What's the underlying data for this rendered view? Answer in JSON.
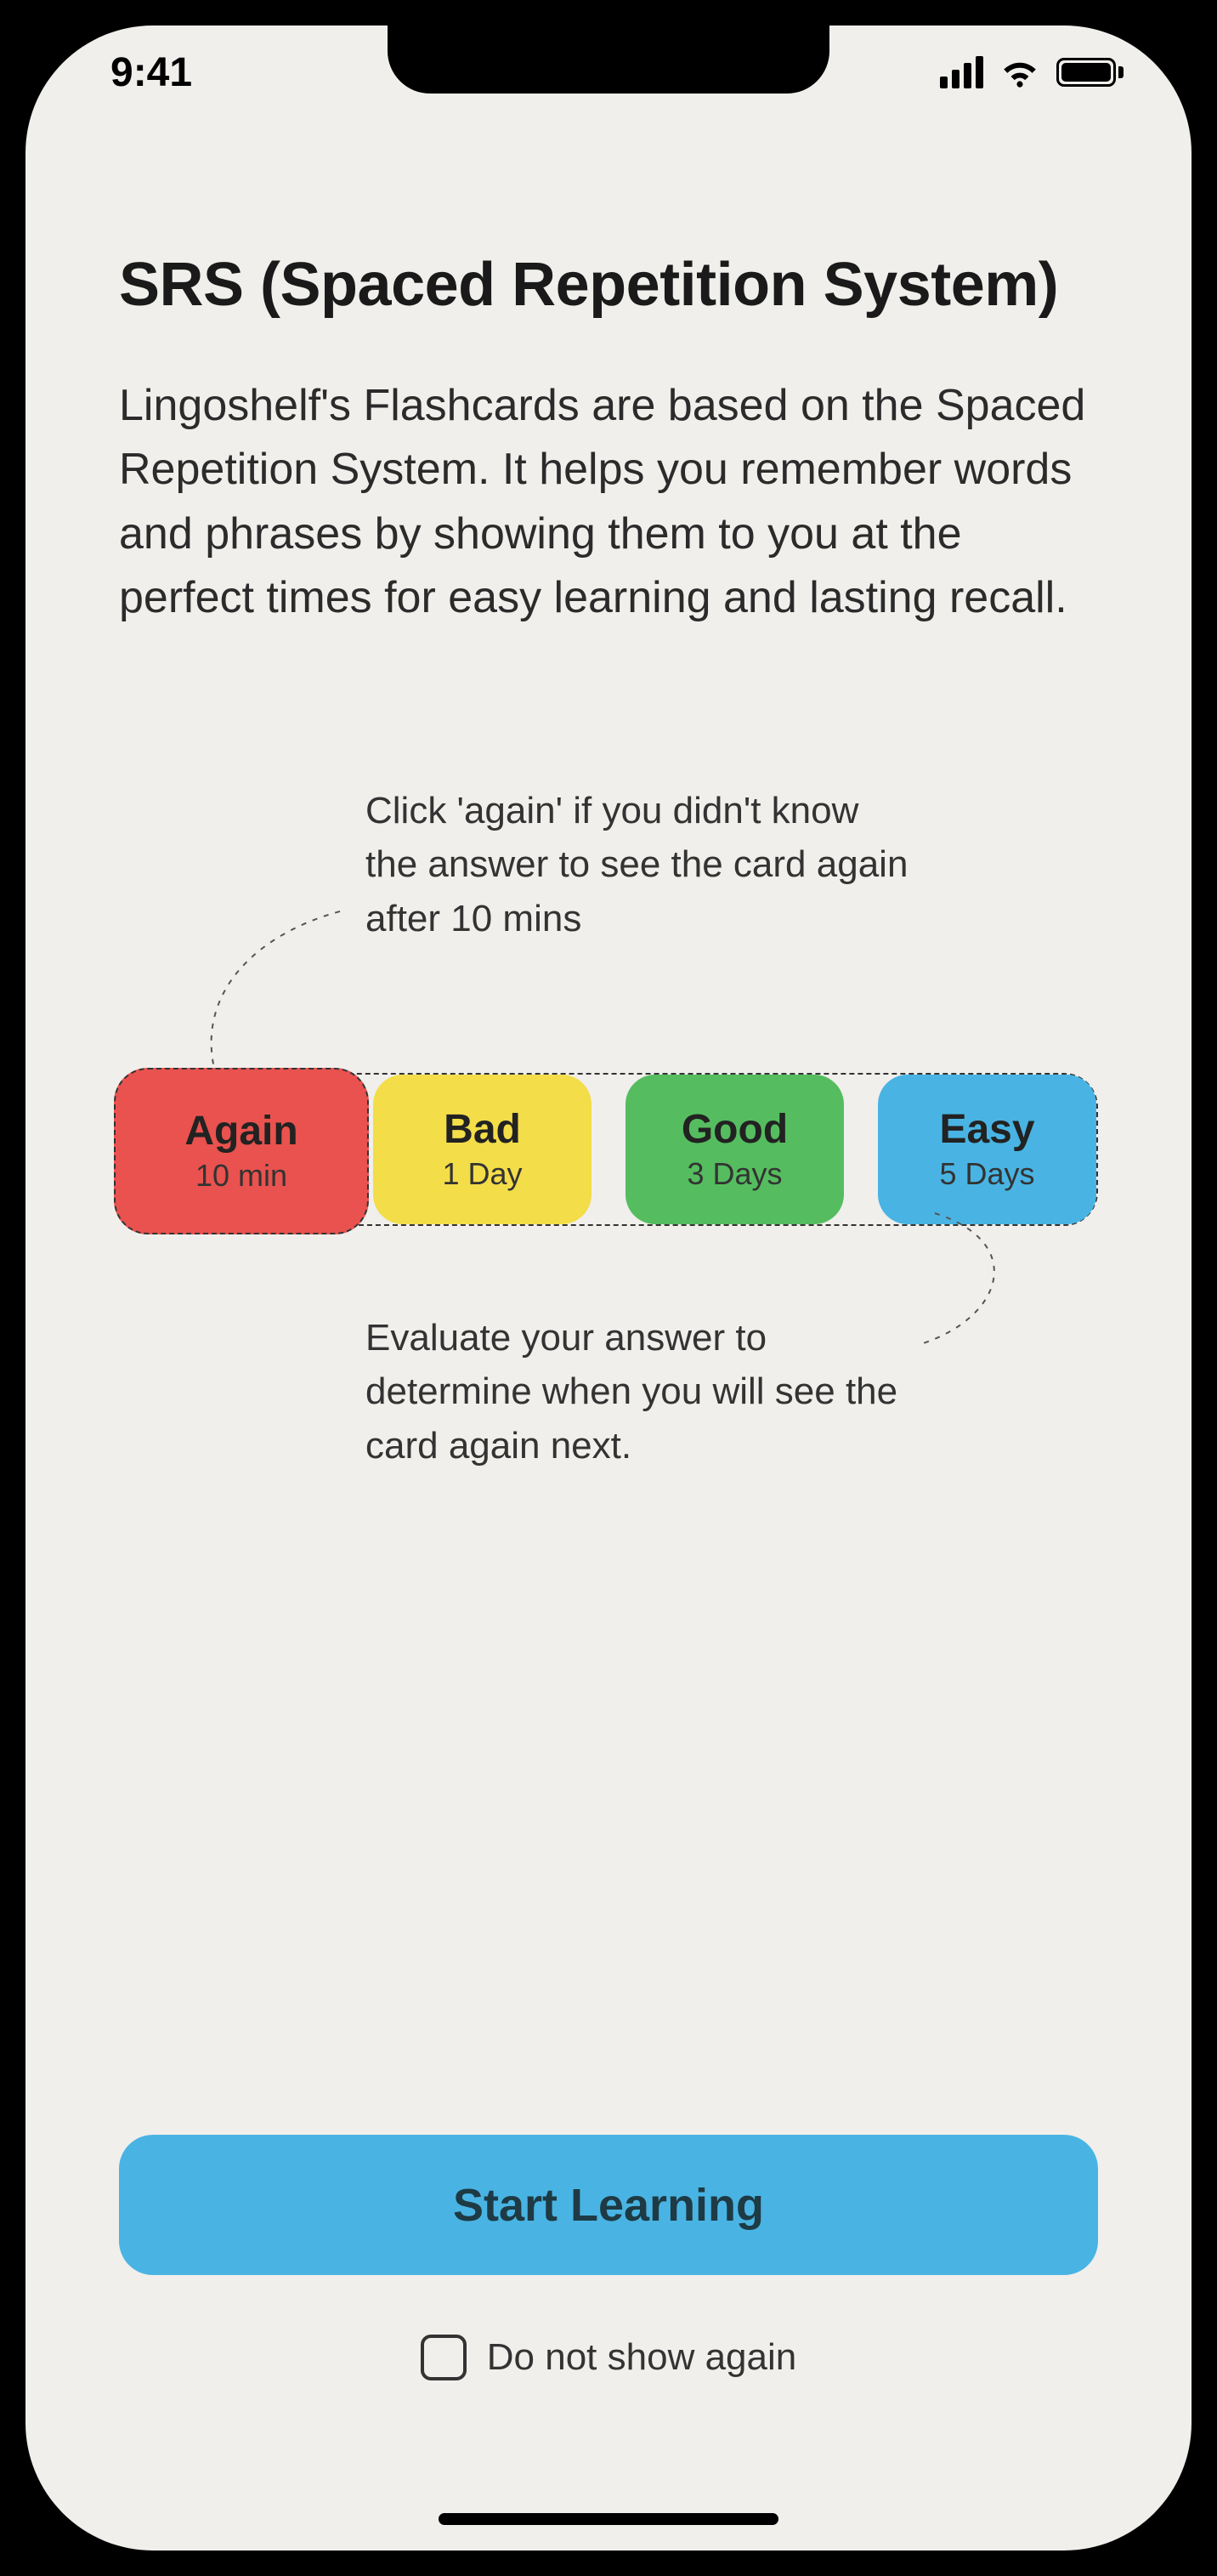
{
  "status": {
    "time": "9:41"
  },
  "page": {
    "title": "SRS (Spaced Repetition System)",
    "description": "Lingoshelf's Flashcards are based on the Spaced Repetition System. It helps you remember words and phrases by showing them to you at the perfect times for easy learning and lasting recall."
  },
  "diagram": {
    "hint_top": "Click 'again' if you didn't know the answer to see the card again after 10 mins",
    "hint_bottom": "Evaluate your answer to determine when you will see the card again next.",
    "buttons": {
      "again": {
        "label": "Again",
        "sub": "10 min",
        "color": "#e9524e"
      },
      "bad": {
        "label": "Bad",
        "sub": "1 Day",
        "color": "#f3dd49"
      },
      "good": {
        "label": "Good",
        "sub": "3 Days",
        "color": "#55bd5f"
      },
      "easy": {
        "label": "Easy",
        "sub": "5 Days",
        "color": "#49b4e3"
      }
    }
  },
  "footer": {
    "start_label": "Start Learning",
    "checkbox_label": "Do not show again"
  },
  "colors": {
    "background": "#f0efec",
    "primary_button": "#49b4e3"
  }
}
